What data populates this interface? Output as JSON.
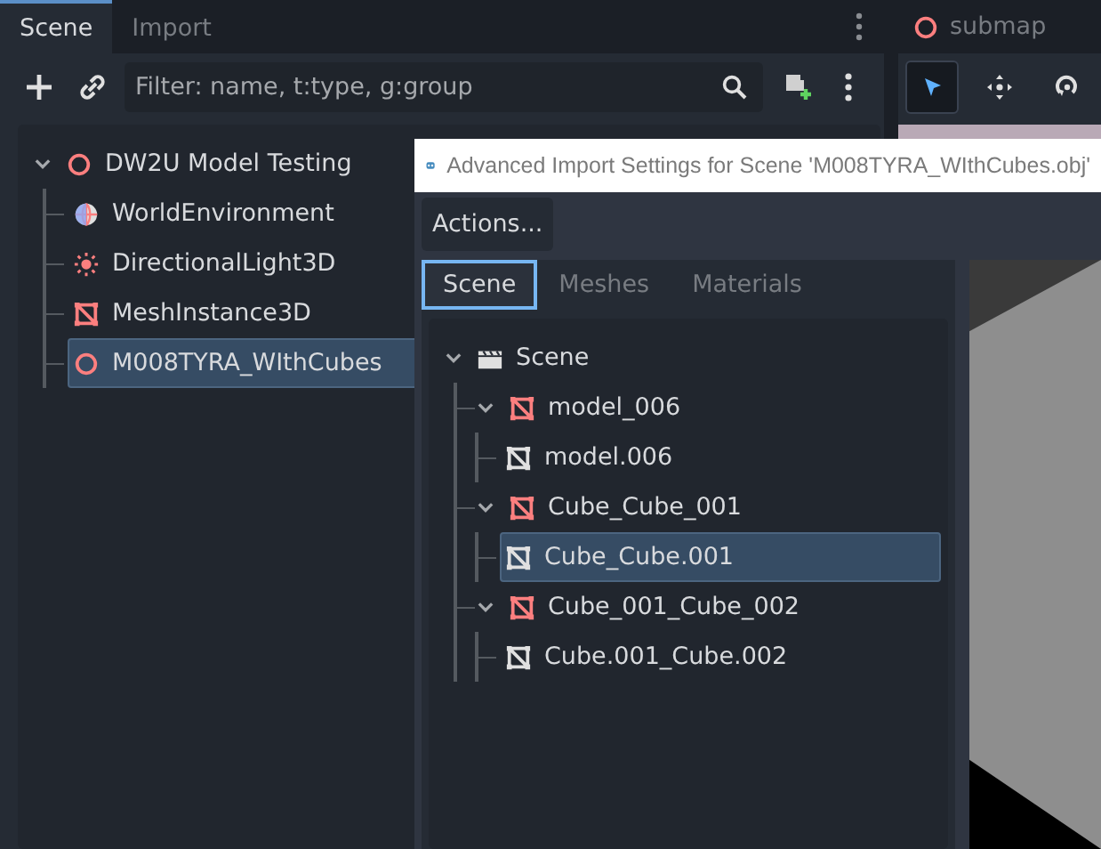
{
  "scene_dock": {
    "tabs": [
      {
        "label": "Scene",
        "selected": true
      },
      {
        "label": "Import",
        "selected": false
      }
    ],
    "filter": {
      "placeholder": "Filter: name, t:type, g:group"
    },
    "tree": [
      {
        "label": "DW2U Model Testing",
        "kind": "node3d",
        "selected": false,
        "expanded": true,
        "children": [
          {
            "label": "WorldEnvironment",
            "kind": "world",
            "selected": false
          },
          {
            "label": "DirectionalLight3D",
            "kind": "light",
            "selected": false
          },
          {
            "label": "MeshInstance3D",
            "kind": "mesh",
            "selected": false
          },
          {
            "label": "M008TYRA_WIthCubes",
            "kind": "node3d",
            "selected": true
          }
        ]
      }
    ]
  },
  "viewport": {
    "tab": {
      "label": "submap"
    },
    "tools": [
      {
        "kind": "select",
        "selected": true
      },
      {
        "kind": "move",
        "selected": false
      },
      {
        "kind": "rotate",
        "selected": false
      }
    ]
  },
  "dialog": {
    "title": "Advanced Import Settings for Scene 'M008TYRA_WIthCubes.obj'",
    "actions_button": "Actions...",
    "tabs": [
      {
        "label": "Scene",
        "selected": true
      },
      {
        "label": "Meshes",
        "selected": false
      },
      {
        "label": "Materials",
        "selected": false
      }
    ],
    "tree": [
      {
        "label": "Scene",
        "kind": "scene",
        "selected": false,
        "expanded": true,
        "children": [
          {
            "label": "model_006",
            "kind": "mesh",
            "selected": false,
            "expanded": true,
            "children": [
              {
                "label": "model.006",
                "kind": "mesh_data",
                "selected": false
              }
            ]
          },
          {
            "label": "Cube_Cube_001",
            "kind": "mesh",
            "selected": false,
            "expanded": true,
            "children": [
              {
                "label": "Cube_Cube.001",
                "kind": "mesh_data",
                "selected": true
              }
            ]
          },
          {
            "label": "Cube_001_Cube_002",
            "kind": "mesh",
            "selected": false,
            "expanded": true,
            "children": [
              {
                "label": "Cube.001_Cube.002",
                "kind": "mesh_data",
                "selected": false
              }
            ]
          }
        ]
      }
    ]
  }
}
